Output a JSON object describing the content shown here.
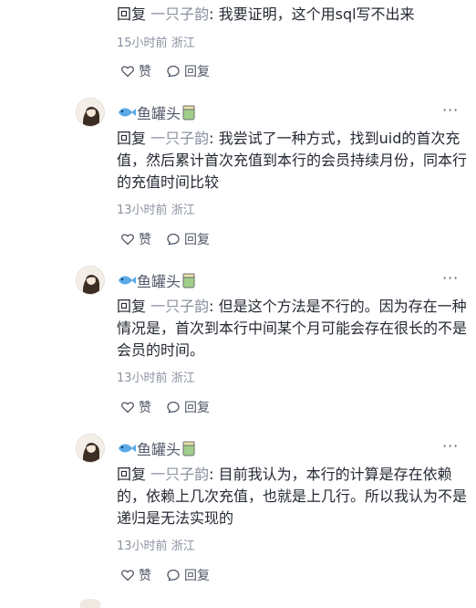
{
  "top": {
    "reply_word": "回复",
    "mention": "一只子韵",
    "separator": ": ",
    "content": "我要证明，这个用sql写不出来",
    "time": "15小时前",
    "location": "浙江",
    "like_label": "赞",
    "reply_label": "回复"
  },
  "comments": [
    {
      "user": "鱼罐头",
      "reply_word": "回复",
      "mention": "一只子韵",
      "separator": ": ",
      "content": "我尝试了一种方式，找到uid的首次充值，然后累计首次充值到本行的会员持续月份，同本行的充值时间比较",
      "time": "13小时前",
      "location": "浙江",
      "like_label": "赞",
      "reply_label": "回复",
      "more": "···"
    },
    {
      "user": "鱼罐头",
      "reply_word": "回复",
      "mention": "一只子韵",
      "separator": ": ",
      "content": "但是这个方法是不行的。因为存在一种情况是，首次到本行中间某个月可能会存在很长的不是会员的时间。",
      "time": "13小时前",
      "location": "浙江",
      "like_label": "赞",
      "reply_label": "回复",
      "more": "···"
    },
    {
      "user": "鱼罐头",
      "reply_word": "回复",
      "mention": "一只子韵",
      "separator": ": ",
      "content": "目前我认为，本行的计算是存在依赖的，依赖上几次充值，也就是上几行。所以我认为不是递归是无法实现的",
      "time": "13小时前",
      "location": "浙江",
      "like_label": "赞",
      "reply_label": "回复",
      "more": "···"
    }
  ]
}
